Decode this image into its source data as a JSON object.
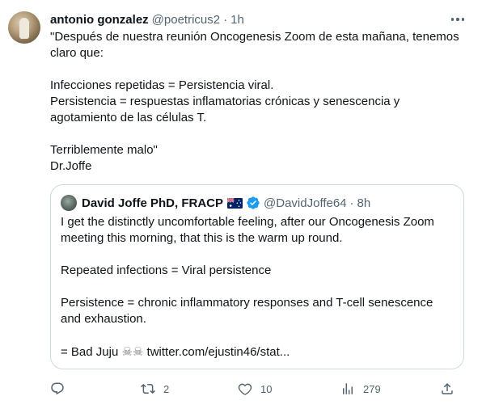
{
  "author": {
    "name": "antonio gonzalez",
    "handle": "@poetricus2",
    "separator": "·",
    "time": "1h"
  },
  "tweet_text": "\"Después de nuestra reunión Oncogenesis Zoom de esta mañana, tenemos claro que:\n\nInfecciones repetidas = Persistencia viral.\nPersistencia = respuestas inflamatorias crónicas y senescencia y agotamiento de las células T.\n\nTerriblemente malo\"\nDr.Joffe",
  "quoted": {
    "name": "David Joffe PhD, FRACP",
    "handle": "@DavidJoffe64",
    "separator": "·",
    "time": "8h",
    "text_main": "I get the distinctly uncomfortable feeling, after our Oncogenesis Zoom meeting this morning, that this is the warm up round.\n\nRepeated infections = Viral persistence\n\nPersistence = chronic inflammatory responses and T-cell senescence and exhaustion.\n\n= Bad Juju ",
    "skulls": "☠☠",
    "link": " twitter.com/ejustin46/stat..."
  },
  "actions": {
    "reply_count": "",
    "retweet_count": "2",
    "like_count": "10",
    "views_count": "279"
  },
  "colors": {
    "text": "#0f1419",
    "secondary": "#536471",
    "border": "#cfd9de",
    "verified": "#1d9bf0"
  },
  "icons": [
    "more-icon",
    "flag-australia-icon",
    "verified-badge-icon",
    "reply-icon",
    "retweet-icon",
    "like-icon",
    "views-icon",
    "share-icon"
  ]
}
